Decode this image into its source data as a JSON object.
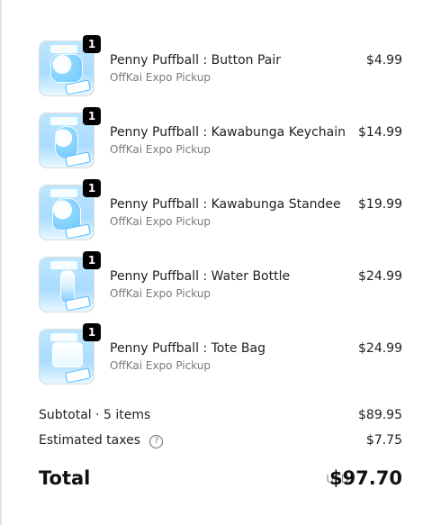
{
  "order_summary": {
    "items": [
      {
        "title": "Penny Puffball : Button Pair",
        "subtitle": "OffKai Expo Pickup",
        "price": "$4.99",
        "quantity": "1",
        "thumbnail_icon": "button-pair-product-thumbnail"
      },
      {
        "title": "Penny Puffball : Kawabunga Keychain",
        "subtitle": "OffKai Expo Pickup",
        "price": "$14.99",
        "quantity": "1",
        "thumbnail_icon": "keychain-product-thumbnail"
      },
      {
        "title": "Penny Puffball : Kawabunga Standee",
        "subtitle": "OffKai Expo Pickup",
        "price": "$19.99",
        "quantity": "1",
        "thumbnail_icon": "standee-product-thumbnail"
      },
      {
        "title": "Penny Puffball : Water Bottle",
        "subtitle": "OffKai Expo Pickup",
        "price": "$24.99",
        "quantity": "1",
        "thumbnail_icon": "water-bottle-product-thumbnail"
      },
      {
        "title": "Penny Puffball : Tote Bag",
        "subtitle": "OffKai Expo Pickup",
        "price": "$24.99",
        "quantity": "1",
        "thumbnail_icon": "tote-bag-product-thumbnail"
      }
    ],
    "subtotal_label": "Subtotal · 5 items",
    "subtotal_value": "$89.95",
    "taxes_label": "Estimated taxes",
    "taxes_help_icon": "question-circle-icon",
    "taxes_value": "$7.75",
    "total_label": "Total",
    "total_currency": "USD",
    "total_value": "$97.70"
  },
  "colors": {
    "page_background": "#ffffff",
    "primary_text": "#222222",
    "secondary_text": "#7a7a7a",
    "badge_background": "#000000",
    "thumbnail_blue": "#a8dcff"
  }
}
